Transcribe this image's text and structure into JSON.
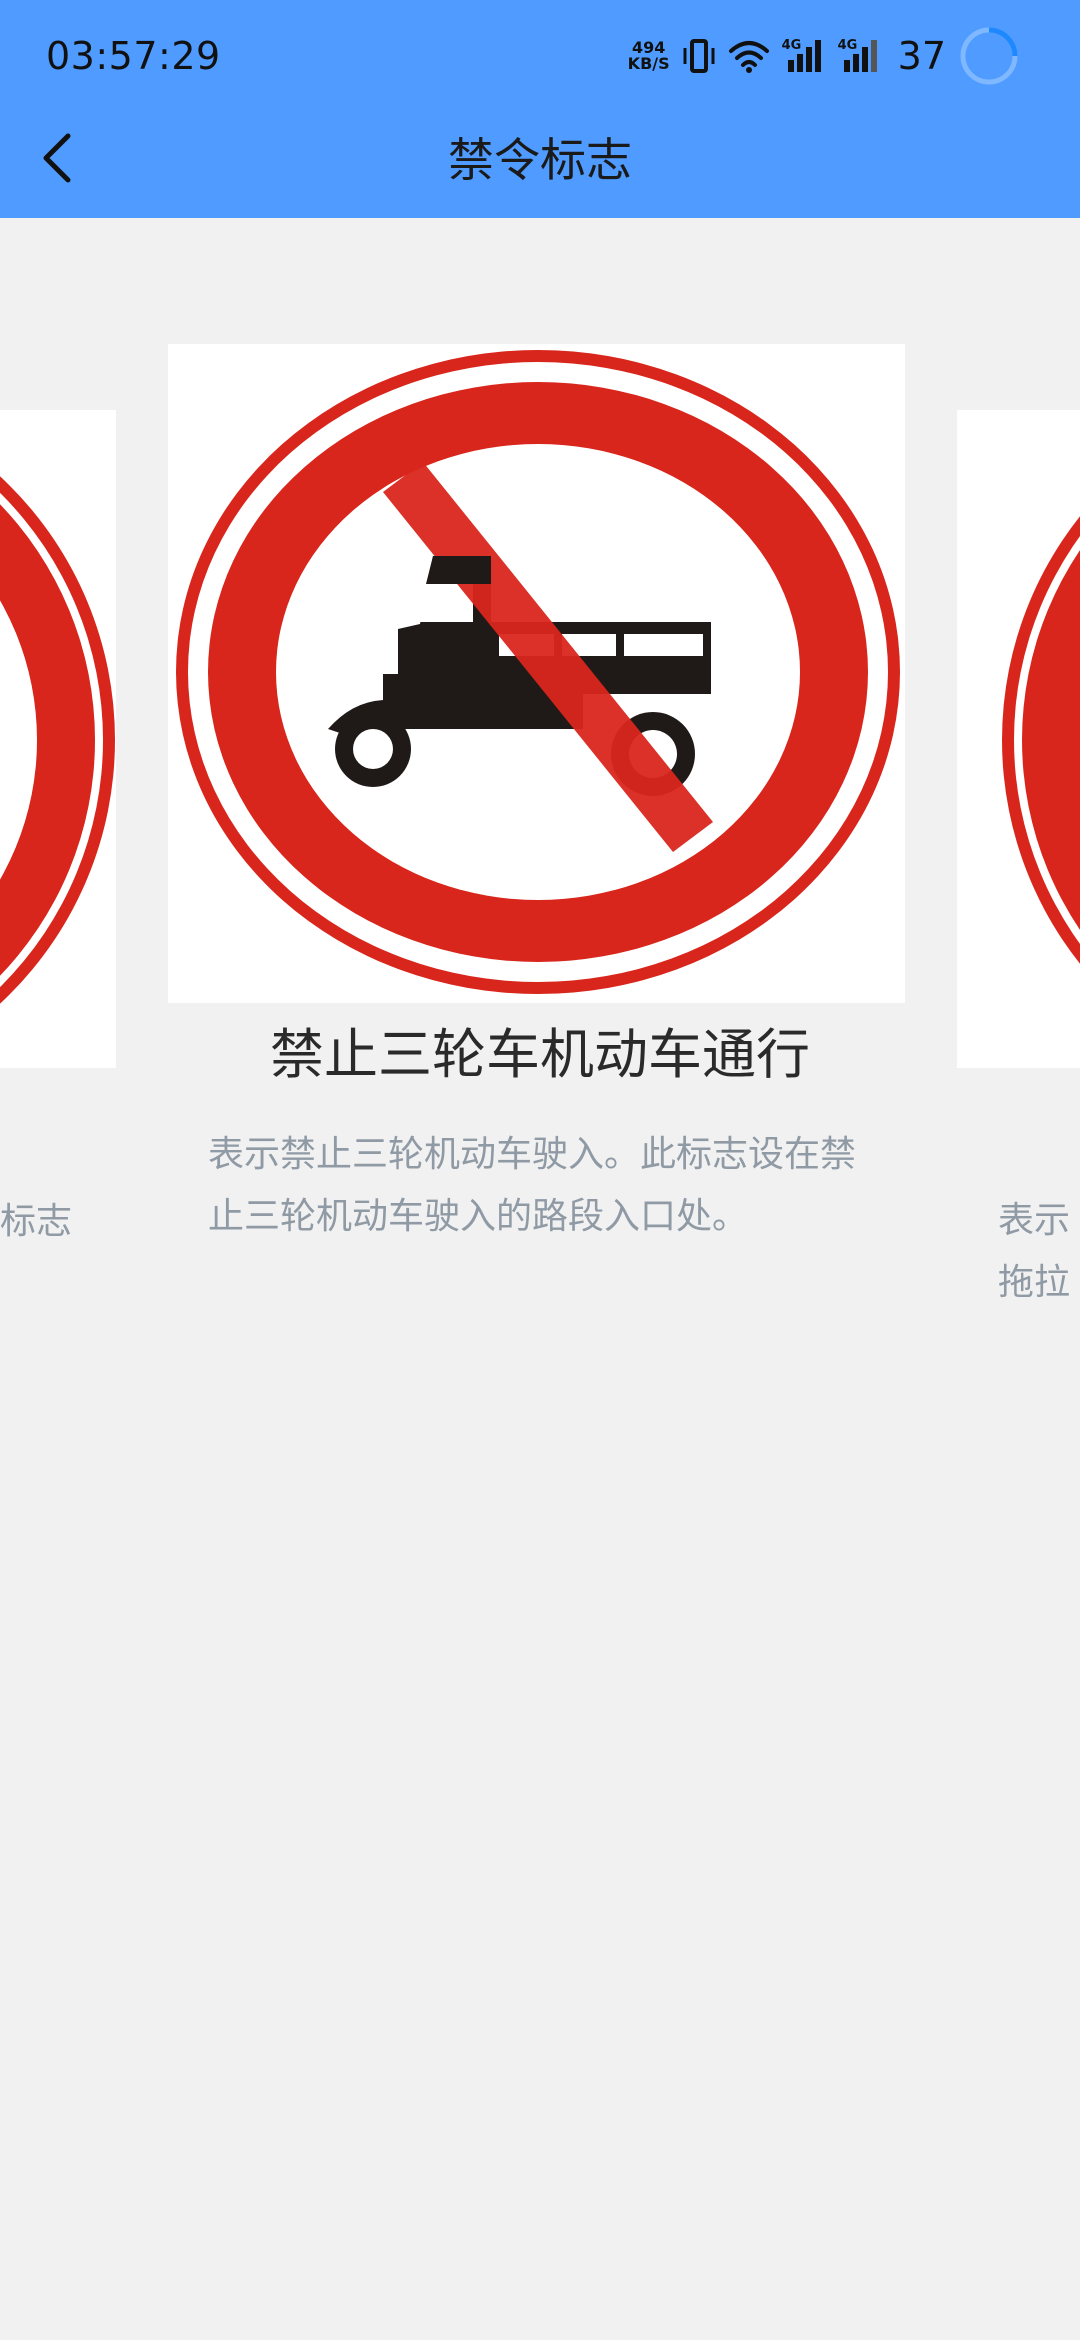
{
  "status_bar": {
    "time": "03:57:29",
    "net_speed_value": "494",
    "net_speed_unit": "KB/S",
    "network_label_1": "4G",
    "network_label_2": "4G",
    "battery": "37"
  },
  "header": {
    "title": "禁令标志"
  },
  "main_card": {
    "title": "禁止三轮车机动车通行",
    "description": "表示禁止三轮机动车驶入。此标志设在禁止三轮机动车驶入的路段入口处。"
  },
  "left_card": {
    "description_fragment": "标志"
  },
  "right_card": {
    "description_fragment_line1": "表示",
    "description_fragment_line2": "拖拉"
  },
  "colors": {
    "appbar": "#4f9bff",
    "background": "#f1f1f1",
    "sign_red": "#d9261c",
    "description_text": "#8f9aa5"
  },
  "icons": {
    "back": "chevron-left-icon",
    "vibrate": "vibrate-icon",
    "wifi": "wifi-icon",
    "signal": "signal-icon",
    "loading": "loading-ring-icon"
  }
}
